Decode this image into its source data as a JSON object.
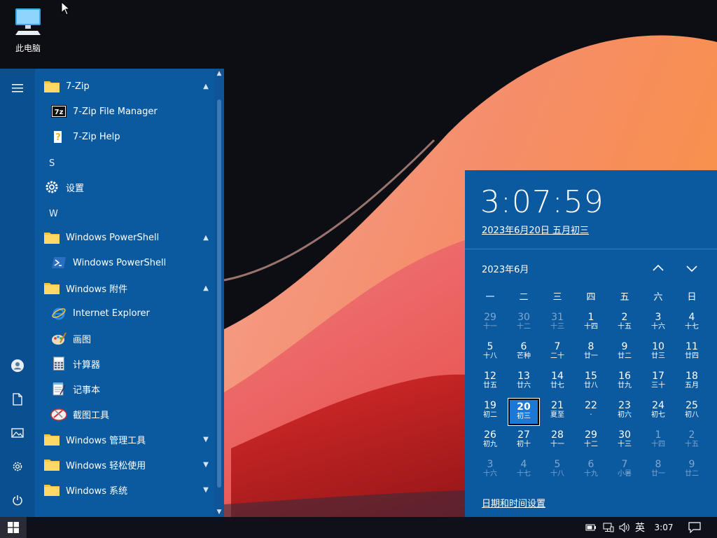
{
  "desktop": {
    "icon_label": "此电脑"
  },
  "start_menu": {
    "items": [
      {
        "kind": "folder",
        "label": "7-Zip",
        "chevron": "up",
        "icon": "folder-icon"
      },
      {
        "kind": "app",
        "label": "7-Zip File Manager",
        "icon": "seven-zip-icon"
      },
      {
        "kind": "app",
        "label": "7-Zip Help",
        "icon": "help-icon"
      },
      {
        "kind": "letter",
        "label": "S"
      },
      {
        "kind": "folderapp",
        "label": "设置",
        "icon": "gear-icon"
      },
      {
        "kind": "letter",
        "label": "W"
      },
      {
        "kind": "folder",
        "label": "Windows PowerShell",
        "chevron": "up",
        "icon": "folder-icon"
      },
      {
        "kind": "app",
        "label": "Windows PowerShell",
        "icon": "powershell-icon"
      },
      {
        "kind": "folder",
        "label": "Windows 附件",
        "chevron": "up",
        "icon": "folder-icon"
      },
      {
        "kind": "app",
        "label": "Internet Explorer",
        "icon": "ie-icon"
      },
      {
        "kind": "app",
        "label": "画图",
        "icon": "paint-icon"
      },
      {
        "kind": "app",
        "label": "计算器",
        "icon": "calculator-icon"
      },
      {
        "kind": "app",
        "label": "记事本",
        "icon": "notepad-icon"
      },
      {
        "kind": "app",
        "label": "截图工具",
        "icon": "snipping-icon"
      },
      {
        "kind": "folder",
        "label": "Windows 管理工具",
        "chevron": "down",
        "icon": "folder-icon"
      },
      {
        "kind": "folder",
        "label": "Windows 轻松使用",
        "chevron": "down",
        "icon": "folder-icon"
      },
      {
        "kind": "folder",
        "label": "Windows 系统",
        "chevron": "down",
        "icon": "folder-icon"
      }
    ],
    "rail_icons": [
      "hamburger-icon",
      "user-icon",
      "document-icon",
      "pictures-icon",
      "gear-icon",
      "power-icon"
    ]
  },
  "flyout": {
    "time": "3:07:59",
    "date_link": "2023年6月20日 五月初三",
    "month_label": "2023年6月",
    "weekdays": [
      "一",
      "二",
      "三",
      "四",
      "五",
      "六",
      "日"
    ],
    "days": [
      {
        "n": "29",
        "l": "十一",
        "dim": true
      },
      {
        "n": "30",
        "l": "十二",
        "dim": true
      },
      {
        "n": "31",
        "l": "十三",
        "dim": true
      },
      {
        "n": "1",
        "l": "十四"
      },
      {
        "n": "2",
        "l": "十五"
      },
      {
        "n": "3",
        "l": "十六"
      },
      {
        "n": "4",
        "l": "十七"
      },
      {
        "n": "5",
        "l": "十八"
      },
      {
        "n": "6",
        "l": "芒种"
      },
      {
        "n": "7",
        "l": "二十"
      },
      {
        "n": "8",
        "l": "廿一"
      },
      {
        "n": "9",
        "l": "廿二"
      },
      {
        "n": "10",
        "l": "廿三"
      },
      {
        "n": "11",
        "l": "廿四"
      },
      {
        "n": "12",
        "l": "廿五"
      },
      {
        "n": "13",
        "l": "廿六"
      },
      {
        "n": "14",
        "l": "廿七"
      },
      {
        "n": "15",
        "l": "廿八"
      },
      {
        "n": "16",
        "l": "廿九"
      },
      {
        "n": "17",
        "l": "三十"
      },
      {
        "n": "18",
        "l": "五月"
      },
      {
        "n": "19",
        "l": "初二"
      },
      {
        "n": "20",
        "l": "初三",
        "today": true
      },
      {
        "n": "21",
        "l": "夏至"
      },
      {
        "n": "22",
        "l": "·"
      },
      {
        "n": "23",
        "l": "初六"
      },
      {
        "n": "24",
        "l": "初七"
      },
      {
        "n": "25",
        "l": "初八"
      },
      {
        "n": "26",
        "l": "初九"
      },
      {
        "n": "27",
        "l": "初十"
      },
      {
        "n": "28",
        "l": "十一"
      },
      {
        "n": "29",
        "l": "十二"
      },
      {
        "n": "30",
        "l": "十三"
      },
      {
        "n": "1",
        "l": "十四",
        "dim": true
      },
      {
        "n": "2",
        "l": "十五",
        "dim": true
      },
      {
        "n": "3",
        "l": "十六",
        "dim": true
      },
      {
        "n": "4",
        "l": "十七",
        "dim": true
      },
      {
        "n": "5",
        "l": "十八",
        "dim": true
      },
      {
        "n": "6",
        "l": "十九",
        "dim": true
      },
      {
        "n": "7",
        "l": "小暑",
        "dim": true
      },
      {
        "n": "8",
        "l": "廿一",
        "dim": true
      },
      {
        "n": "9",
        "l": "廿二",
        "dim": true
      }
    ],
    "settings_link": "日期和时间设置"
  },
  "taskbar": {
    "ime": "英",
    "clock": "3:07",
    "tray_icons": [
      "battery-icon",
      "network-icon",
      "volume-icon"
    ]
  },
  "colors": {
    "accent": "#0b5aa0",
    "today": "#1c78d4"
  }
}
